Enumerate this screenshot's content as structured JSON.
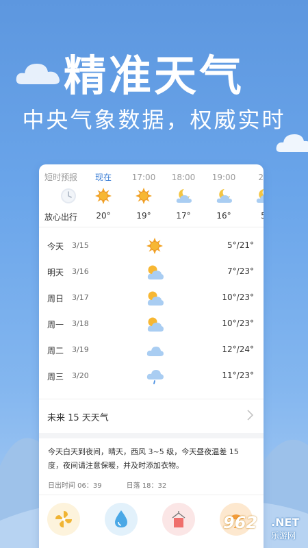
{
  "banner": {
    "title": "精准天气",
    "subtitle": "中央气象数据，权威实时"
  },
  "hourly": {
    "section_label": "短时预报",
    "section_sub": "放心出行",
    "items": [
      {
        "time": "现在",
        "icon": "sun-icon",
        "temp": "20°"
      },
      {
        "time": "17:00",
        "icon": "sun-icon",
        "temp": "19°"
      },
      {
        "time": "18:00",
        "icon": "moon-cloud-icon",
        "temp": "17°"
      },
      {
        "time": "19:00",
        "icon": "moon-cloud-icon",
        "temp": "16°"
      },
      {
        "time": "20",
        "icon": "moon-cloud-icon",
        "temp": "5"
      }
    ]
  },
  "daily": [
    {
      "day": "今天",
      "date": "3/15",
      "icon": "sun-icon",
      "temp": "5°/21°"
    },
    {
      "day": "明天",
      "date": "3/16",
      "icon": "partly-cloudy-icon",
      "temp": "7°/23°"
    },
    {
      "day": "周日",
      "date": "3/17",
      "icon": "partly-cloudy-icon",
      "temp": "10°/23°"
    },
    {
      "day": "周一",
      "date": "3/18",
      "icon": "partly-cloudy-icon",
      "temp": "10°/23°"
    },
    {
      "day": "周二",
      "date": "3/19",
      "icon": "cloud-icon",
      "temp": "12°/24°"
    },
    {
      "day": "周三",
      "date": "3/20",
      "icon": "light-rain-icon",
      "temp": "11°/23°"
    }
  ],
  "forecast_link": {
    "label": "未来 15 天天气"
  },
  "summary": {
    "text": "今天白天到夜间，晴天，西风 3~5 级，今天昼夜温差 15 度，夜间请注意保暖，并及时添加衣物。",
    "sunrise_label": "日出时间 06：39",
    "sunset_label": "日落 18：32"
  },
  "life_icons": [
    "fan-icon",
    "water-drop-icon",
    "clothes-icon",
    "umbrella-icon"
  ],
  "watermark": {
    "brand": "962",
    "net": ".NET",
    "sub": "乐游网"
  },
  "colors": {
    "accent": "#3d7fd6",
    "sun": "#f2a324",
    "cloud": "#a9cdf2",
    "moon": "#f4c542"
  }
}
